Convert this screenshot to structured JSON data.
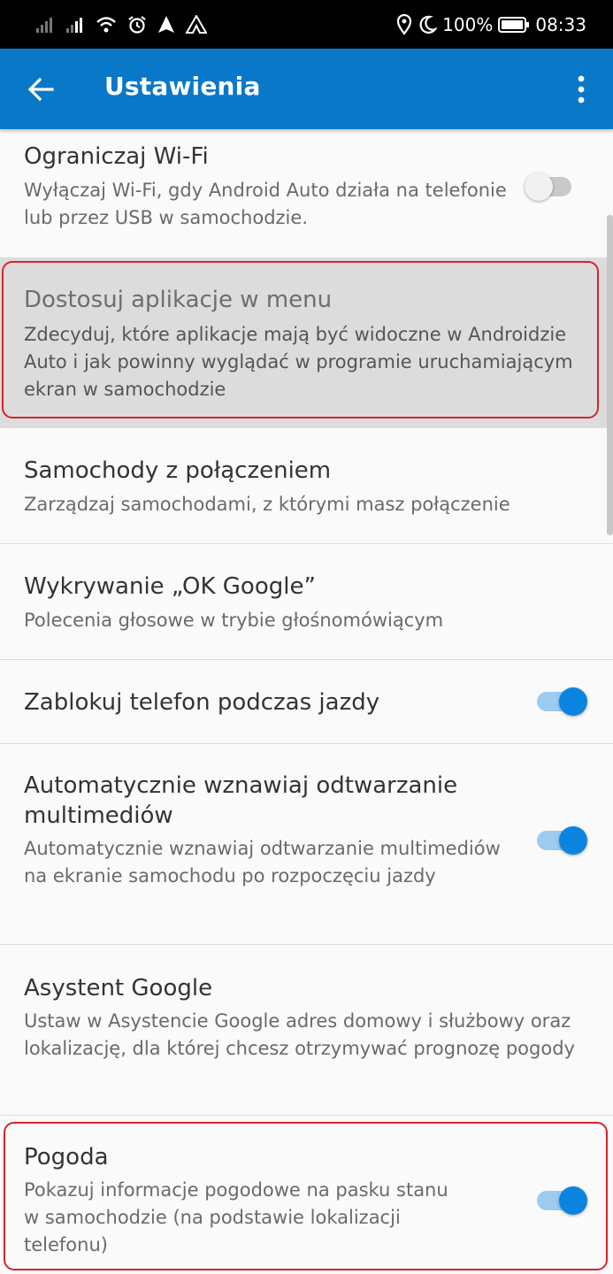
{
  "status_bar": {
    "battery": "100%",
    "time": "08:33"
  },
  "app_bar": {
    "title": "Ustawienia"
  },
  "settings": [
    {
      "title": "Ograniczaj Wi-Fi",
      "subtitle": "Wyłączaj Wi-Fi, gdy Android Auto działa na telefonie lub przez USB w samochodzie.",
      "toggle": "off"
    },
    {
      "title": "Dostosuj aplikacje w menu",
      "subtitle": "Zdecyduj, które aplikacje mają być widoczne w Androidzie Auto i jak powinny wyglądać w programie uruchamiającym ekran w samochodzie"
    },
    {
      "title": "Samochody z połączeniem",
      "subtitle": "Zarządzaj samochodami, z którymi masz połączenie"
    },
    {
      "title": "Wykrywanie „OK Google”",
      "subtitle": "Polecenia głosowe w trybie głośnomówiącym"
    },
    {
      "title": "Zablokuj telefon podczas jazdy",
      "toggle": "on"
    },
    {
      "title": "Automatycznie wznawiaj odtwarzanie multimediów",
      "subtitle": "Automatycznie wznawiaj odtwarzanie multimediów na ekranie samochodu po rozpoczęciu jazdy",
      "toggle": "on"
    },
    {
      "title": "Asystent Google",
      "subtitle": "Ustaw w Asystencie Google adres domowy i służbowy oraz lokalizację, dla której chcesz otrzymywać prognozę pogody"
    },
    {
      "title": "Pogoda",
      "subtitle": "Pokazuj informacje pogodowe na pasku stanu w samochodzie (na podstawie lokalizacji telefonu)",
      "toggle": "on"
    }
  ],
  "colors": {
    "app_bar": "#0a78c8",
    "toggle_on": "#0b84e0",
    "highlight": "#d8232a"
  }
}
